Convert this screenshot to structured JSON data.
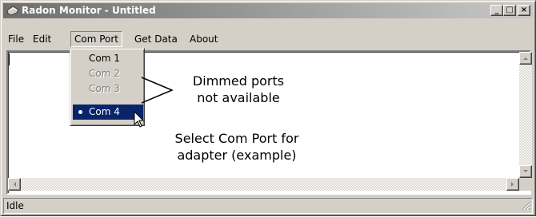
{
  "window": {
    "title": "Radon Monitor - Untitled",
    "icon": "radon-app-icon",
    "buttons": {
      "minimize": "_",
      "maximize": "□",
      "close": "×"
    }
  },
  "menubar": {
    "items": [
      {
        "label": "File"
      },
      {
        "label": "Edit"
      },
      {
        "label": "Com Port"
      },
      {
        "label": "Get Data"
      },
      {
        "label": "About"
      }
    ]
  },
  "com_port_menu": {
    "items": [
      {
        "label": "Com 1",
        "enabled": true,
        "selected": false
      },
      {
        "label": "Com 2",
        "enabled": false,
        "selected": false
      },
      {
        "label": "Com 3",
        "enabled": false,
        "selected": false
      },
      {
        "label": "Com 4",
        "enabled": true,
        "selected": true
      }
    ]
  },
  "annotations": {
    "dimmed_line1": "Dimmed ports",
    "dimmed_line2": "not available",
    "select_line1": "Select Com Port for",
    "select_line2": "adapter (example)"
  },
  "statusbar": {
    "text": "Idle"
  },
  "colors": {
    "face": "#d4d0c8",
    "highlight": "#0a246a",
    "disabled_text": "#808080",
    "titlebar_start": "#6e6e6e",
    "titlebar_end": "#c8c8c8"
  }
}
